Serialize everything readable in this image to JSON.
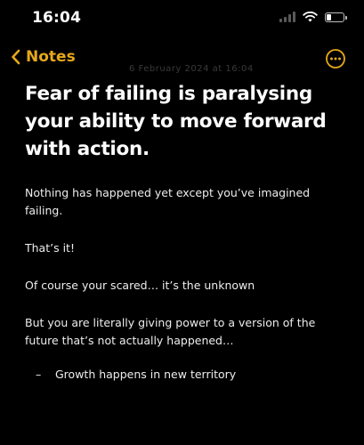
{
  "status_bar": {
    "time": "16:04",
    "icons": [
      "signal-icon",
      "wifi-icon",
      "battery-icon"
    ]
  },
  "nav": {
    "back_label": "Notes",
    "back_icon": "chevron-left-icon",
    "more_icon": "ellipsis-circle-icon",
    "faded_date": "6 February 2024 at 16:04"
  },
  "note": {
    "title": "Fear of failing is paralysing your ability to move forward with action.",
    "paragraphs": [
      "Nothing has happened yet except you’ve imagined failing.",
      "That’s it!",
      "Of course your scared… it’s the unknown",
      "But you are  literally giving power to a version of the future that’s not actually happened…"
    ],
    "bullets": [
      {
        "mark": "–",
        "text": "Growth happens in new territory"
      }
    ]
  },
  "colors": {
    "background": "#000000",
    "accent": "#E6A81A",
    "text": "#FFFFFF"
  }
}
